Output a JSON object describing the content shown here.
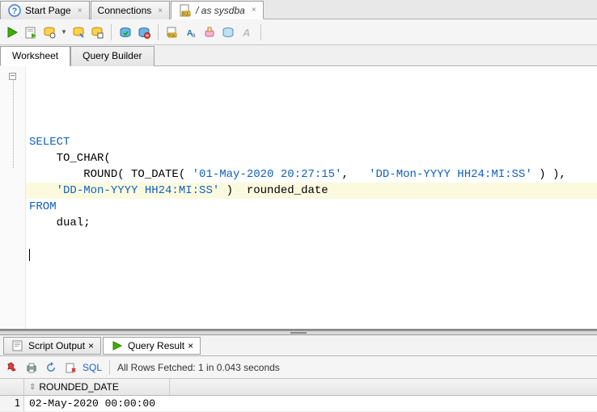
{
  "top_tabs": [
    {
      "label": "Start Page",
      "icon": "help-icon"
    },
    {
      "label": "Connections",
      "icon": "blank-icon"
    },
    {
      "label": "/ as sysdba",
      "icon": "sql-file-icon",
      "active": true,
      "italic": true
    }
  ],
  "work_tabs": [
    {
      "label": "Worksheet",
      "active": true
    },
    {
      "label": "Query Builder",
      "active": false
    }
  ],
  "sql": {
    "kw_select": "SELECT",
    "l2": "    TO_CHAR(",
    "l3a": "        ROUND( TO_DATE( ",
    "l3s1": "'01-May-2020 20:27:15'",
    "l3b": ",   ",
    "l3s2": "'DD-Mon-YYYY HH24:MI:SS'",
    "l3c": " ) ),",
    "l4a": "    ",
    "l4s": "'DD-Mon-YYYY HH24:MI:SS'",
    "l4b": " )  rounded_date",
    "kw_from": "FROM",
    "l6": "    dual;"
  },
  "result_tabs": [
    {
      "label": "Script Output",
      "active": false
    },
    {
      "label": "Query Result",
      "active": true
    }
  ],
  "result_toolbar": {
    "sql_label": "SQL",
    "status": "All Rows Fetched: 1 in 0.043 seconds"
  },
  "grid": {
    "columns": [
      "ROUNDED_DATE"
    ],
    "rows": [
      {
        "n": "1",
        "cells": [
          "02-May-2020 00:00:00"
        ]
      }
    ]
  }
}
